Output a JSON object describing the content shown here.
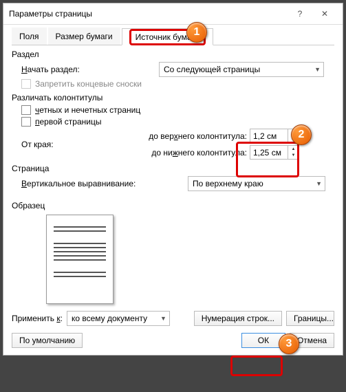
{
  "titlebar": {
    "title": "Параметры страницы"
  },
  "tabs": {
    "fields": "Поля",
    "paperSize": "Размер бумаги",
    "paperSource": "Источник бумаги"
  },
  "section": {
    "legend": "Раздел",
    "startLabel": "Начать раздел:",
    "startValue": "Со следующей страницы",
    "noEndnotes": "Запретить концевые сноски"
  },
  "headersFooters": {
    "legend": "Различать колонтитулы",
    "oddEven": "четных и нечетных страниц",
    "firstPage": "первой страницы",
    "fromEdgeLabel": "От края:",
    "headerLabel": "до верхнего колонтитула:",
    "footerLabel": "до нижнего колонтитула:",
    "headerValue": "1,2 см",
    "footerValue": "1,25 см"
  },
  "page": {
    "legend": "Страница",
    "vertAlignLabel": "Вертикальное выравнивание:",
    "vertAlignValue": "По верхнему краю"
  },
  "preview": {
    "legend": "Образец"
  },
  "applyTo": {
    "label": "Применить к:",
    "value": "ко всему документу"
  },
  "buttons": {
    "lineNumbers": "Нумерация строк...",
    "borders": "Границы...",
    "default": "По умолчанию",
    "ok": "ОК",
    "cancel": "Отмена"
  },
  "badges": {
    "b1": "1",
    "b2": "2",
    "b3": "3"
  }
}
